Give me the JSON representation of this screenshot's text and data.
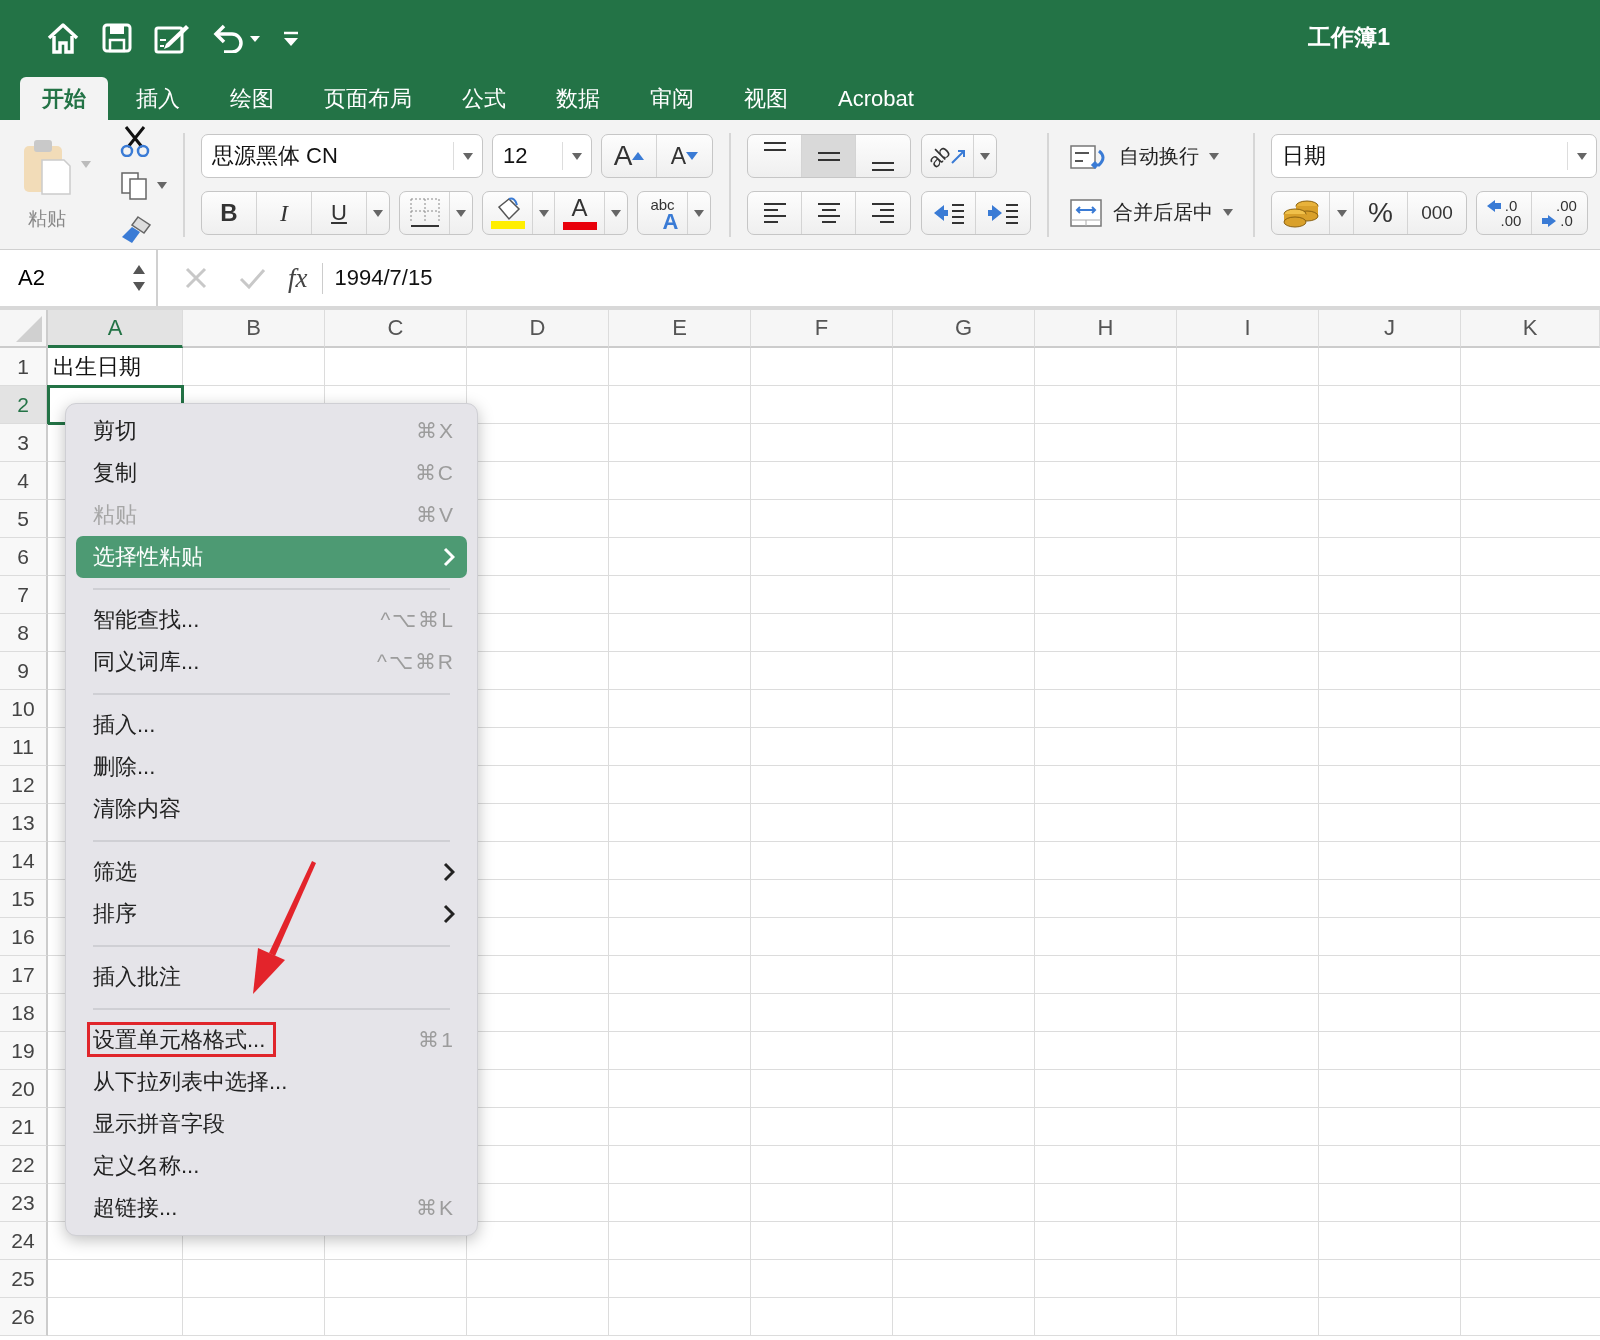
{
  "title_bar": {
    "title": "工作簿1"
  },
  "tabs": [
    {
      "label": "开始",
      "selected": true
    },
    {
      "label": "插入",
      "selected": false
    },
    {
      "label": "绘图",
      "selected": false
    },
    {
      "label": "页面布局",
      "selected": false
    },
    {
      "label": "公式",
      "selected": false
    },
    {
      "label": "数据",
      "selected": false
    },
    {
      "label": "审阅",
      "selected": false
    },
    {
      "label": "视图",
      "selected": false
    },
    {
      "label": "Acrobat",
      "selected": false
    }
  ],
  "ribbon": {
    "clipboard": {
      "paste_label": "粘贴"
    },
    "font": {
      "font_name": "思源黑体 CN",
      "font_size": "12",
      "grow_label": "A",
      "shrink_label": "A",
      "bold_label": "B",
      "italic_label": "I",
      "underline_label": "U",
      "font_color_label": "A",
      "phonetic_labels": [
        "abc",
        "A"
      ]
    },
    "alignment": {
      "vertical": [
        {
          "selected": false
        },
        {
          "selected": true
        },
        {
          "selected": false
        }
      ],
      "orientation_label": "ab"
    },
    "wrap_label": "自动换行",
    "merge_label": "合并后居中",
    "number": {
      "format": "日期",
      "percent_label": "%",
      "comma_label": "000",
      "increase_decimal_labels": [
        ".0",
        ".00"
      ],
      "decrease_decimal_labels": [
        ".00",
        ".0"
      ]
    }
  },
  "formula_bar": {
    "name_box": "A2",
    "fx_label": "fx",
    "formula": "1994/7/15"
  },
  "sheet": {
    "columns": [
      {
        "label": "A",
        "selected": true
      },
      {
        "label": "B",
        "selected": false
      },
      {
        "label": "C",
        "selected": false
      },
      {
        "label": "D",
        "selected": false
      },
      {
        "label": "E",
        "selected": false
      },
      {
        "label": "F",
        "selected": false
      },
      {
        "label": "G",
        "selected": false
      },
      {
        "label": "H",
        "selected": false
      },
      {
        "label": "I",
        "selected": false
      },
      {
        "label": "J",
        "selected": false
      },
      {
        "label": "K",
        "selected": false
      }
    ],
    "rows": [
      {
        "number": "1",
        "selected": false,
        "cells": [
          "出生日期"
        ]
      },
      {
        "number": "2",
        "selected": true
      },
      {
        "number": "3",
        "selected": false
      },
      {
        "number": "4",
        "selected": false
      },
      {
        "number": "5",
        "selected": false
      },
      {
        "number": "6",
        "selected": false
      },
      {
        "number": "7",
        "selected": false
      },
      {
        "number": "8",
        "selected": false
      },
      {
        "number": "9",
        "selected": false
      },
      {
        "number": "10",
        "selected": false
      },
      {
        "number": "11",
        "selected": false
      },
      {
        "number": "12",
        "selected": false
      },
      {
        "number": "13",
        "selected": false
      },
      {
        "number": "14",
        "selected": false
      },
      {
        "number": "15",
        "selected": false
      },
      {
        "number": "16",
        "selected": false
      },
      {
        "number": "17",
        "selected": false
      },
      {
        "number": "18",
        "selected": false
      },
      {
        "number": "19",
        "selected": false
      },
      {
        "number": "20",
        "selected": false
      },
      {
        "number": "21",
        "selected": false
      },
      {
        "number": "22",
        "selected": false
      },
      {
        "number": "23",
        "selected": false
      },
      {
        "number": "24",
        "selected": false
      },
      {
        "number": "25",
        "selected": false
      },
      {
        "number": "26",
        "selected": false
      }
    ]
  },
  "context_menu": {
    "items": [
      {
        "kind": "item",
        "label": "剪切",
        "shortcut": "⌘X",
        "disabled": false,
        "selected": false,
        "submenu": false,
        "outlined": false
      },
      {
        "kind": "item",
        "label": "复制",
        "shortcut": "⌘C",
        "disabled": false,
        "selected": false,
        "submenu": false,
        "outlined": false
      },
      {
        "kind": "item",
        "label": "粘贴",
        "shortcut": "⌘V",
        "disabled": true,
        "selected": false,
        "submenu": false,
        "outlined": false
      },
      {
        "kind": "item",
        "label": "选择性粘贴",
        "disabled": false,
        "selected": true,
        "submenu": true,
        "outlined": false
      },
      {
        "kind": "separator"
      },
      {
        "kind": "item",
        "label": "智能查找...",
        "shortcut": "^⌥⌘L",
        "disabled": false,
        "selected": false,
        "submenu": false,
        "outlined": false
      },
      {
        "kind": "item",
        "label": "同义词库...",
        "shortcut": "^⌥⌘R",
        "disabled": false,
        "selected": false,
        "submenu": false,
        "outlined": false
      },
      {
        "kind": "separator"
      },
      {
        "kind": "item",
        "label": "插入...",
        "disabled": false,
        "selected": false,
        "submenu": false,
        "outlined": false
      },
      {
        "kind": "item",
        "label": "删除...",
        "disabled": false,
        "selected": false,
        "submenu": false,
        "outlined": false
      },
      {
        "kind": "item",
        "label": "清除内容",
        "disabled": false,
        "selected": false,
        "submenu": false,
        "outlined": false
      },
      {
        "kind": "separator"
      },
      {
        "kind": "item",
        "label": "筛选",
        "disabled": false,
        "selected": false,
        "submenu": true,
        "outlined": false
      },
      {
        "kind": "item",
        "label": "排序",
        "disabled": false,
        "selected": false,
        "submenu": true,
        "outlined": false
      },
      {
        "kind": "separator"
      },
      {
        "kind": "item",
        "label": "插入批注",
        "disabled": false,
        "selected": false,
        "submenu": false,
        "outlined": false
      },
      {
        "kind": "separator"
      },
      {
        "kind": "item",
        "label": "设置单元格格式...",
        "shortcut": "⌘1",
        "disabled": false,
        "selected": false,
        "submenu": false,
        "outlined": true
      },
      {
        "kind": "item",
        "label": "从下拉列表中选择...",
        "disabled": false,
        "selected": false,
        "submenu": false,
        "outlined": false
      },
      {
        "kind": "item",
        "label": "显示拼音字段",
        "disabled": false,
        "selected": false,
        "submenu": false,
        "outlined": false
      },
      {
        "kind": "item",
        "label": "定义名称...",
        "disabled": false,
        "selected": false,
        "submenu": false,
        "outlined": false
      },
      {
        "kind": "item",
        "label": "超链接...",
        "shortcut": "⌘K",
        "disabled": false,
        "selected": false,
        "submenu": false,
        "outlined": false
      }
    ]
  }
}
